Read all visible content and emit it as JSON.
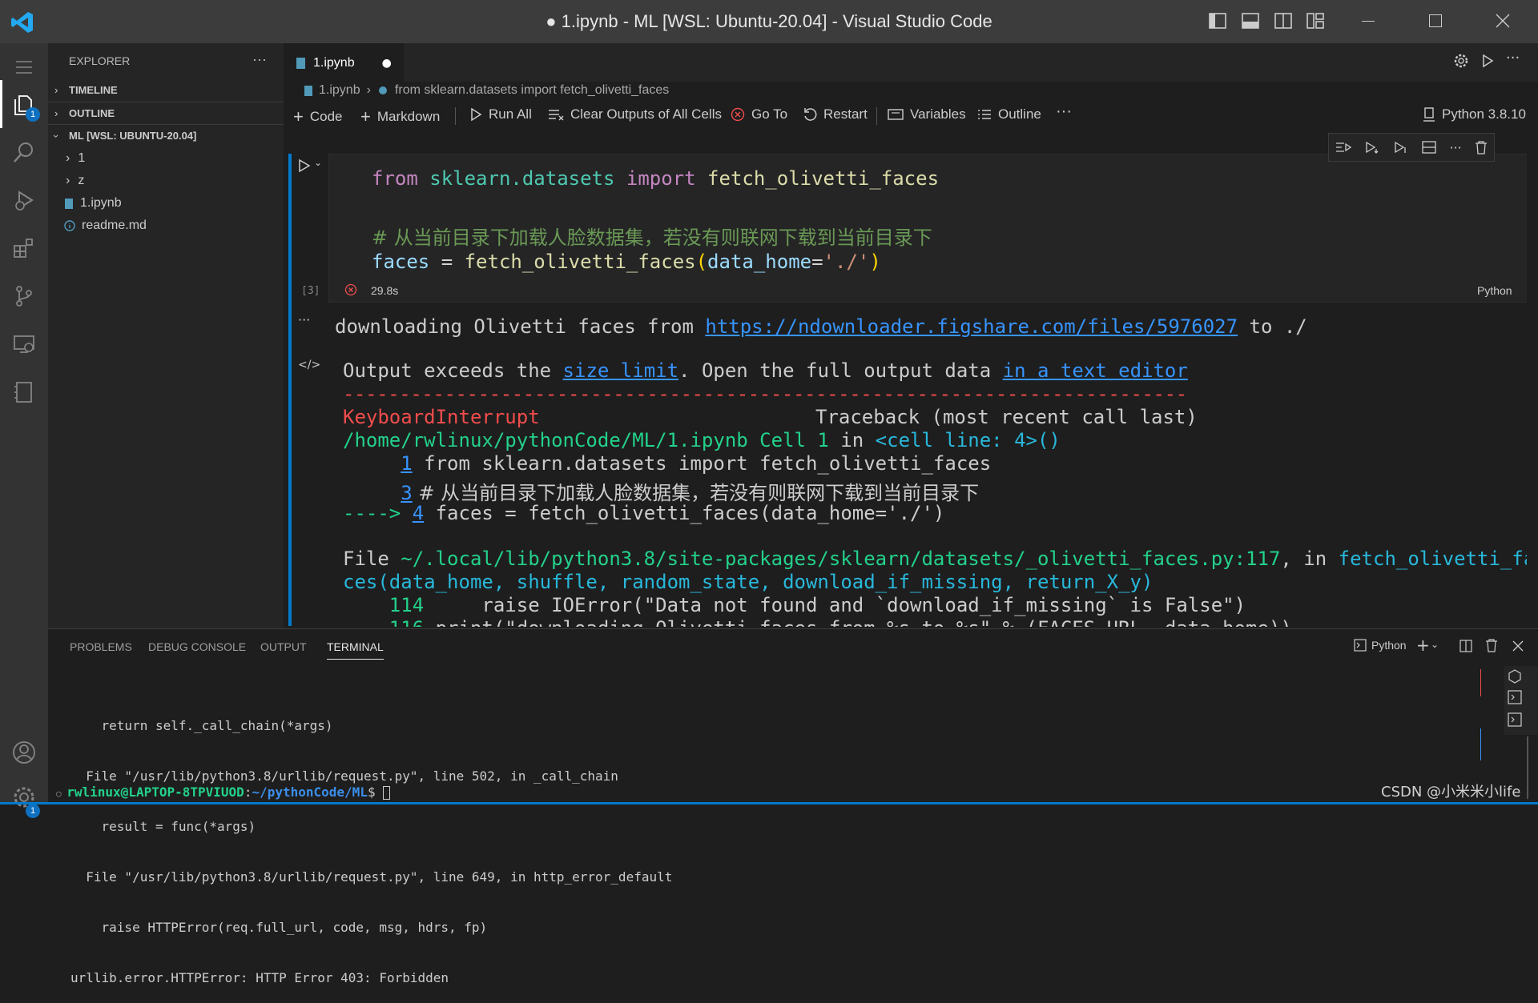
{
  "window": {
    "title": "● 1.ipynb - ML [WSL: Ubuntu-20.04] - Visual Studio Code"
  },
  "activity_bar": {
    "explorer_badge": "1",
    "settings_badge": "1"
  },
  "sidebar": {
    "header": "EXPLORER",
    "more": "···",
    "sections": {
      "timeline": "TIMELINE",
      "outline": "OUTLINE",
      "workspace": "ML [WSL: UBUNTU-20.04]"
    },
    "items": [
      {
        "label": "1",
        "kind": "folder"
      },
      {
        "label": "z",
        "kind": "folder"
      },
      {
        "label": "1.ipynb",
        "kind": "notebook"
      },
      {
        "label": "readme.md",
        "kind": "info"
      }
    ]
  },
  "tab": {
    "label": "1.ipynb",
    "dirty": "●"
  },
  "breadcrumb": {
    "file": "1.ipynb",
    "symbol": "from sklearn.datasets import fetch_olivetti_faces"
  },
  "toolbar": {
    "code": "Code",
    "markdown": "Markdown",
    "run_all": "Run All",
    "clear_outputs": "Clear Outputs of All Cells",
    "go_to": "Go To",
    "restart": "Restart",
    "variables": "Variables",
    "outline": "Outline",
    "more": "···",
    "kernel": "Python 3.8.10"
  },
  "cell": {
    "code_lines": {
      "l1_kw": "from",
      "l1_mod": " sklearn.datasets ",
      "l1_kw2": "import",
      "l1_fn": " fetch_olivetti_faces",
      "l3_comment": "# 从当前目录下加载人脸数据集，若没有则联网下载到当前目录下",
      "l4_var": "faces",
      "l4_op": " = ",
      "l4_fn": "fetch_olivetti_faces",
      "l4_open": "(",
      "l4_param": "data_home",
      "l4_eq": "=",
      "l4_str": "'./'",
      "l4_close": ")"
    },
    "exec_count": "[3]",
    "duration": "29.8s",
    "language": "Python"
  },
  "output": {
    "stream_prefix": "downloading Olivetti faces from ",
    "stream_url": "https://ndownloader.figshare.com/files/5976027",
    "stream_suffix": " to ./",
    "exceeds_a": "Output exceeds the ",
    "exceeds_link1": "size limit",
    "exceeds_b": ". Open the full output data ",
    "exceeds_link2": "in a text editor",
    "dashes": "---------------------------------------------------------------------------",
    "exc_name": "KeyboardInterrupt",
    "traceback_hdr": "Traceback (most recent call last)",
    "cell_path": "/home/rwlinux/pythonCode/ML/1.ipynb Cell 1",
    "in_word": " in ",
    "cell_line": "<cell line: 4>()",
    "tb_line1_no": "1",
    "tb_line1": " from sklearn.datasets import fetch_olivetti_faces",
    "tb_line3_no": "3",
    "tb_line3": " # 从当前目录下加载人脸数据集，若没有则联网下载到当前目录下",
    "arrow": "---->",
    "tb_line4_no": "4",
    "tb_line4": " faces = fetch_olivetti_faces(data_home='./')",
    "file_word": "File ",
    "file_path": "~/.local/lib/python3.8/site-packages/sklearn/datasets/_olivetti_faces.py:117",
    "file_in": ", in ",
    "file_fn1": "fetch_olivetti_fa",
    "file_fn2": "ces(data_home, shuffle, random_state, download_if_missing, return_X_y)",
    "l114_no": "114",
    "l114": "     raise IOError(\"Data not found and `download_if_missing` is False\")",
    "l116_no": "116",
    "l116": " print(\"downloading Olivetti faces from %s to %s\" % (FACES_URL, data_home))"
  },
  "panel": {
    "tabs": [
      "PROBLEMS",
      "DEBUG CONSOLE",
      "OUTPUT",
      "TERMINAL"
    ],
    "active_tab": "TERMINAL",
    "terminal_label": "Python",
    "lines": [
      "    return self._call_chain(*args)",
      "  File \"/usr/lib/python3.8/urllib/request.py\", line 502, in _call_chain",
      "    result = func(*args)",
      "  File \"/usr/lib/python3.8/urllib/request.py\", line 649, in http_error_default",
      "    raise HTTPError(req.full_url, code, msg, hdrs, fp)",
      "urllib.error.HTTPError: HTTP Error 403: Forbidden"
    ],
    "prompt_user": "rwlinux@LAPTOP-8TPVIUOD",
    "prompt_path": "~/pythonCode/ML",
    "prompt_sym": "$ "
  },
  "watermark": "CSDN @小米米小life",
  "colors": {
    "accent": "#007acc",
    "error": "#f14c4c",
    "link": "#3794ff"
  }
}
